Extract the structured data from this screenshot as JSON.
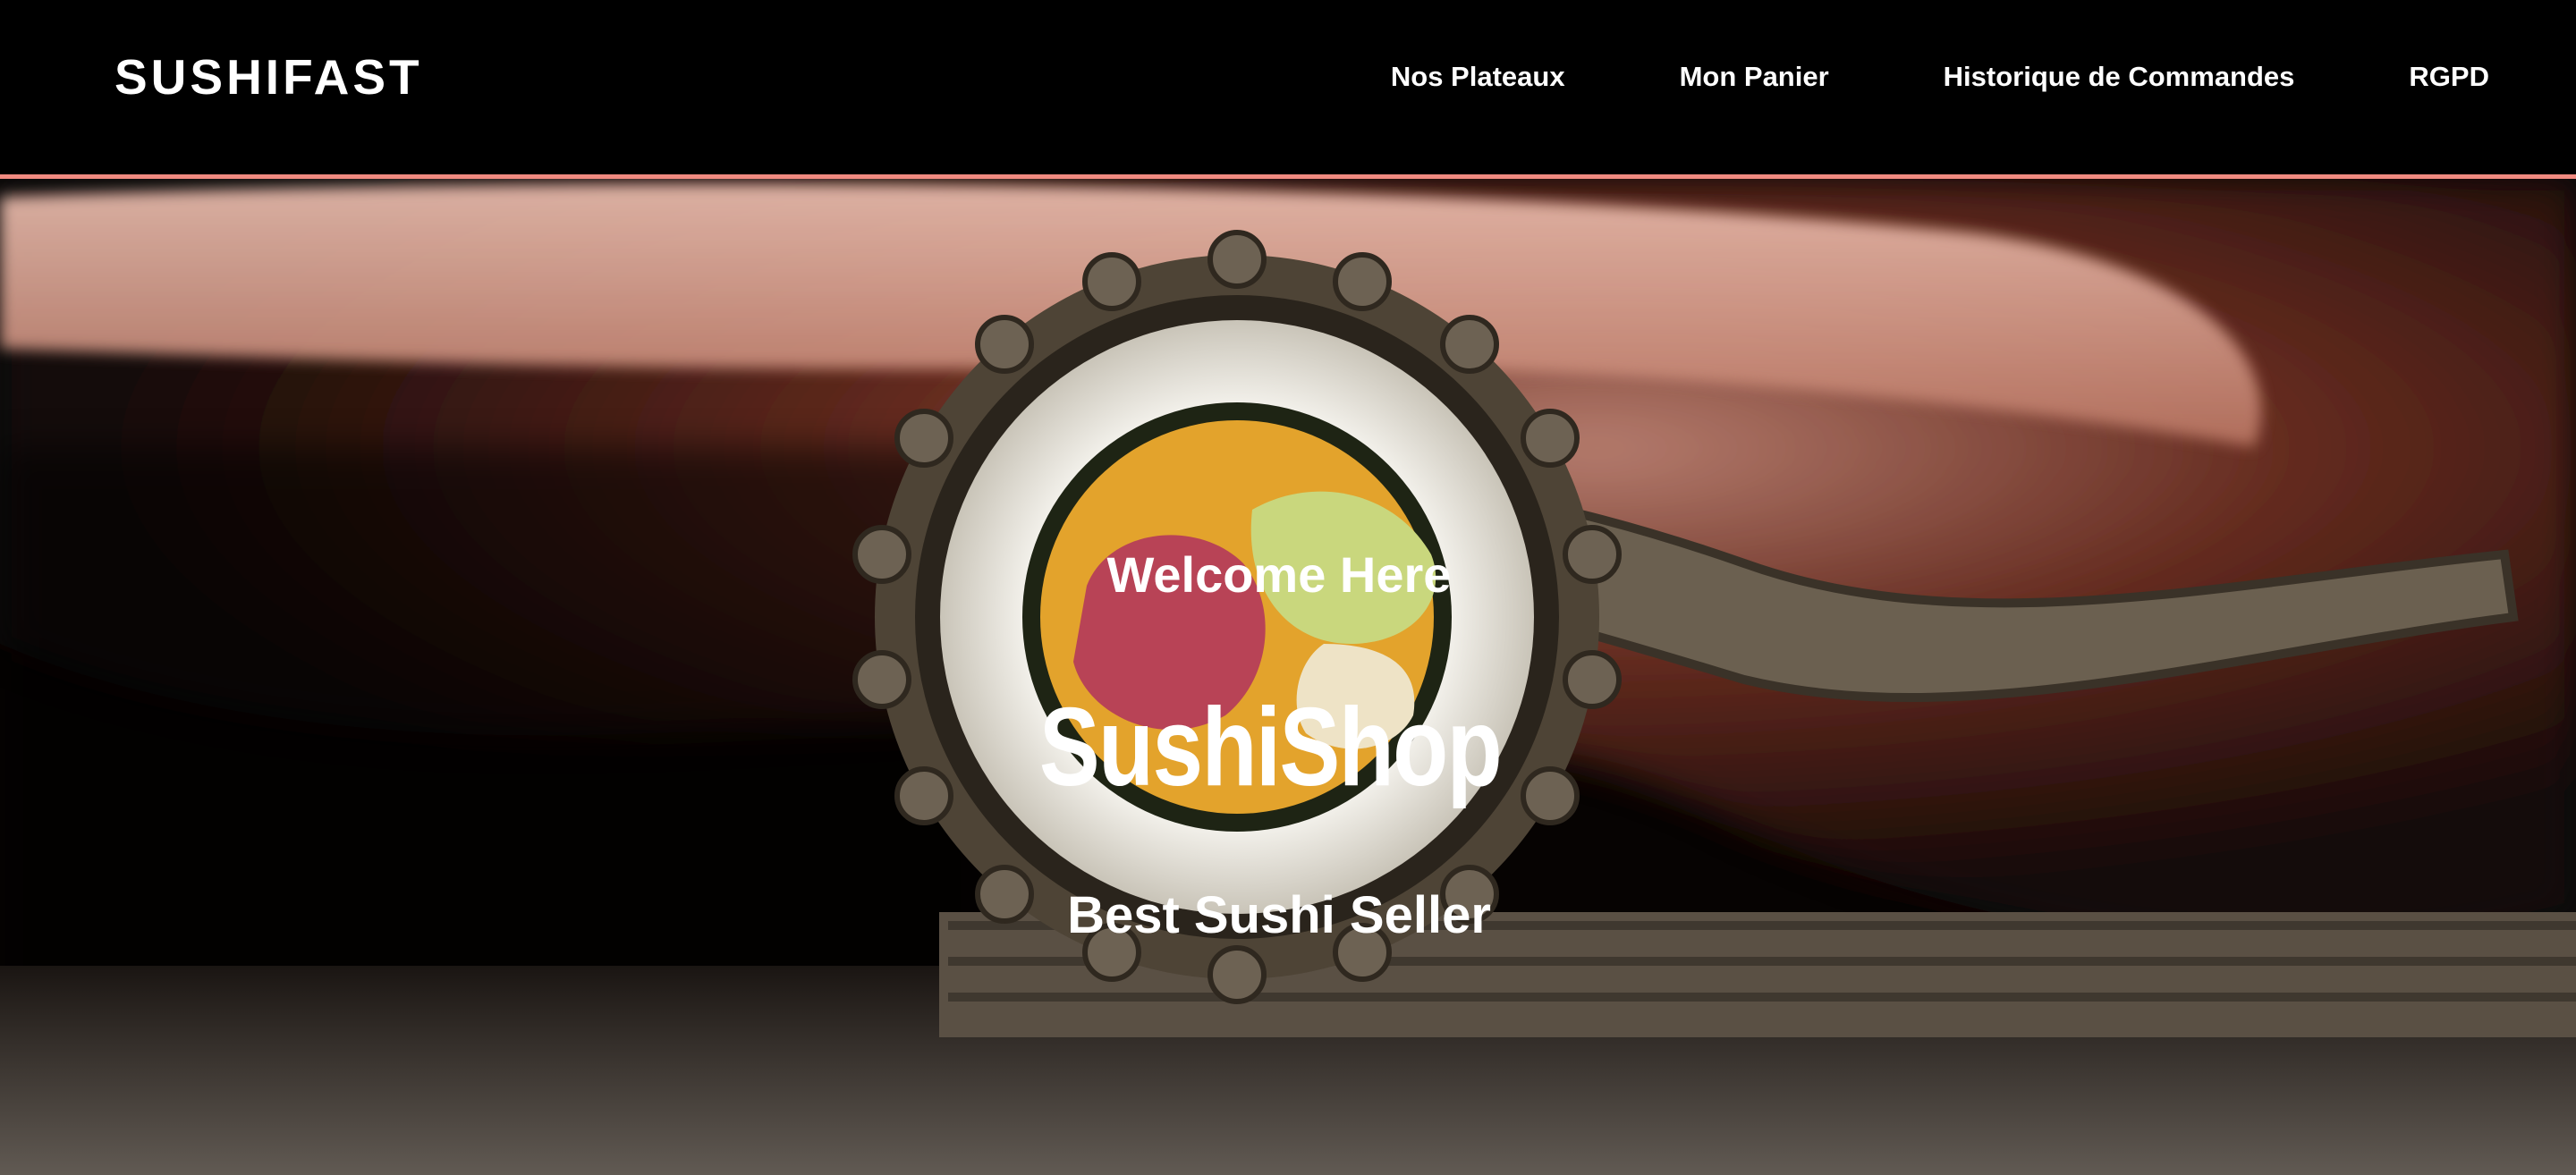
{
  "brand": "SUSHIFAST",
  "nav": {
    "items": [
      {
        "label": "Nos Plateaux"
      },
      {
        "label": "Mon Panier"
      },
      {
        "label": "Historique de Commandes"
      },
      {
        "label": "RGPD"
      }
    ]
  },
  "hero": {
    "welcome": "Welcome Here",
    "title": "SushiShop",
    "subtitle": "Best Sushi Seller"
  },
  "colors": {
    "navbar_background": "#000000",
    "navbar_border_accent": "#f08a80",
    "text": "#ffffff"
  }
}
